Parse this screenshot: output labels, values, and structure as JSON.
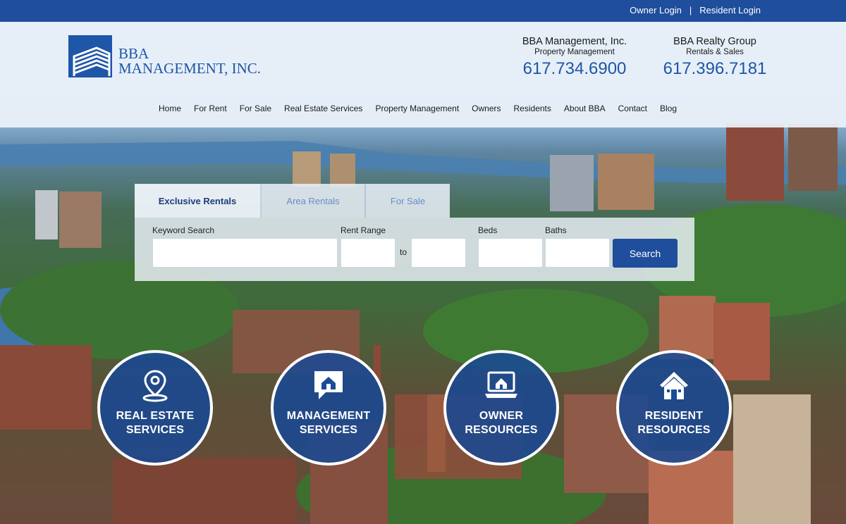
{
  "topbar": {
    "owner_login": "Owner Login",
    "separator": "|",
    "resident_login": "Resident Login"
  },
  "logo": {
    "line1": "BBA",
    "line2": "MANAGEMENT, INC."
  },
  "contacts": [
    {
      "name": "BBA Management, Inc.",
      "subtitle": "Property Management",
      "phone": "617.734.6900"
    },
    {
      "name": "BBA Realty Group",
      "subtitle": "Rentals & Sales",
      "phone": "617.396.7181"
    }
  ],
  "nav": [
    "Home",
    "For Rent",
    "For Sale",
    "Real Estate Services",
    "Property Management",
    "Owners",
    "Residents",
    "About BBA",
    "Contact",
    "Blog"
  ],
  "search": {
    "tabs": [
      "Exclusive Rentals",
      "Area Rentals",
      "For Sale"
    ],
    "active_tab": "Exclusive Rentals",
    "keyword_label": "Keyword Search",
    "rent_label": "Rent Range",
    "to_label": "to",
    "beds_label": "Beds",
    "baths_label": "Baths",
    "keyword_value": "",
    "rent_min_value": "",
    "rent_max_value": "",
    "beds_value": "",
    "baths_value": "",
    "button_label": "Search"
  },
  "features": [
    {
      "line1": "REAL ESTATE",
      "line2": "SERVICES",
      "icon": "location-pin-icon"
    },
    {
      "line1": "MANAGEMENT",
      "line2": "SERVICES",
      "icon": "chat-house-icon"
    },
    {
      "line1": "OWNER",
      "line2": "RESOURCES",
      "icon": "laptop-house-icon"
    },
    {
      "line1": "RESIDENT",
      "line2": "RESOURCES",
      "icon": "house-icon"
    }
  ],
  "colors": {
    "brand_blue": "#1e4e9c",
    "phone_blue": "#1e56a8",
    "header_bg": "#ecf2fa"
  }
}
